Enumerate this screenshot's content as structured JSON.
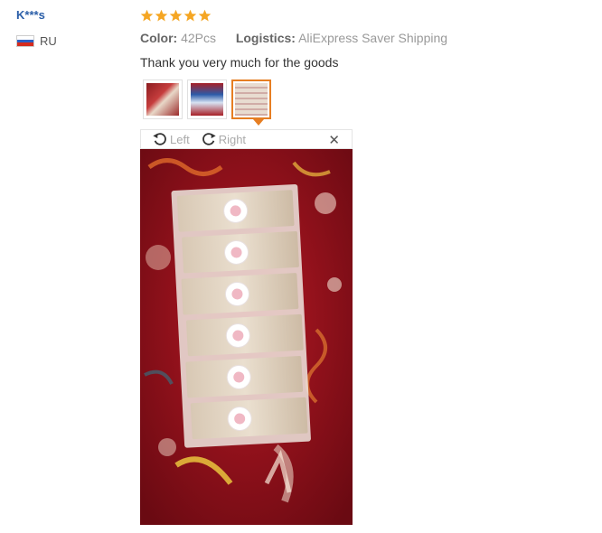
{
  "user": {
    "name": "K***s",
    "country": "RU",
    "flag_icon": "russia-flag-icon"
  },
  "review": {
    "rating": 5,
    "rating_max": 5,
    "star_color": "#f5a623",
    "color_label": "Color:",
    "color_value": "42Pcs",
    "logistics_label": "Logistics:",
    "logistics_value": "AliExpress Saver Shipping",
    "text": "Thank you very much for the goods"
  },
  "gallery": {
    "thumbnails": [
      "photo-thumbnail-1",
      "photo-thumbnail-2",
      "photo-thumbnail-3"
    ],
    "active_index": 2,
    "accent_color": "#e67e22"
  },
  "viewer": {
    "rotate_left_label": "Left",
    "rotate_right_label": "Right",
    "close_icon": "close-icon"
  }
}
